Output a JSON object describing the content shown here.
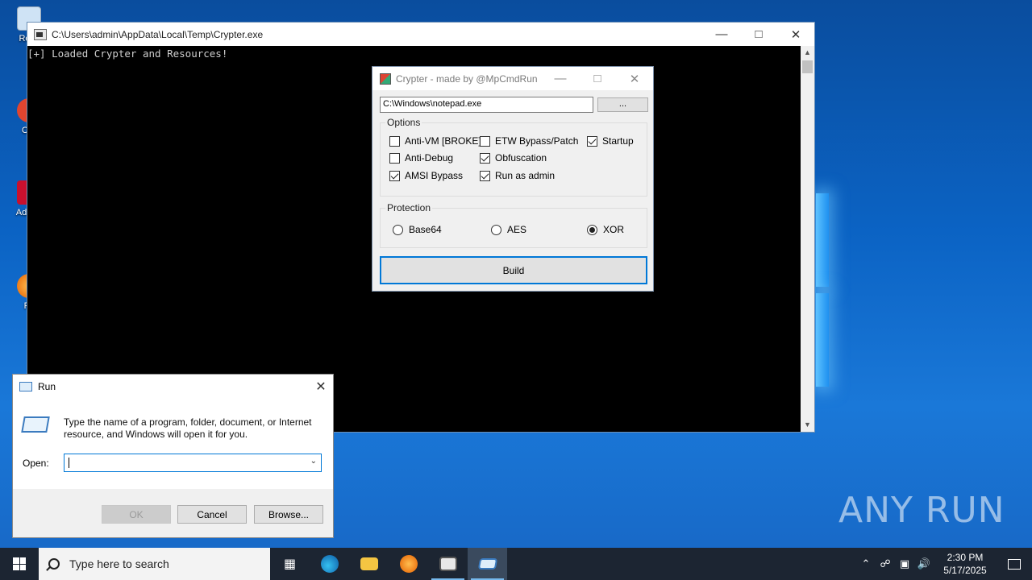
{
  "desktop": {
    "icons": [
      {
        "label": "Recy"
      },
      {
        "label": "CCl"
      },
      {
        "label": "Ad Acr"
      },
      {
        "label": "Fir"
      }
    ],
    "watermark": "ANY RUN"
  },
  "console": {
    "title": "C:\\Users\\admin\\AppData\\Local\\Temp\\Crypter.exe",
    "output": "[+] Loaded Crypter and Resources!"
  },
  "crypter": {
    "title": "Crypter - made by @MpCmdRun",
    "path_value": "C:\\Windows\\notepad.exe",
    "browse_label": "...",
    "options_title": "Options",
    "options": [
      {
        "label": "Anti-VM [BROKE]",
        "checked": false
      },
      {
        "label": "Anti-Debug",
        "checked": false
      },
      {
        "label": "AMSI Bypass",
        "checked": true
      },
      {
        "label": "ETW Bypass/Patch",
        "checked": false
      },
      {
        "label": "Obfuscation",
        "checked": true
      },
      {
        "label": "Run as admin",
        "checked": true
      },
      {
        "label": "Startup",
        "checked": true
      }
    ],
    "protection_title": "Protection",
    "protection": [
      {
        "label": "Base64",
        "selected": false
      },
      {
        "label": "AES",
        "selected": false
      },
      {
        "label": "XOR",
        "selected": true
      }
    ],
    "build_label": "Build"
  },
  "run_dialog": {
    "title": "Run",
    "description": "Type the name of a program, folder, document, or Internet resource, and Windows will open it for you.",
    "open_label": "Open:",
    "open_value": "",
    "ok_label": "OK",
    "cancel_label": "Cancel",
    "browse_label": "Browse..."
  },
  "taskbar": {
    "search_placeholder": "Type here to search",
    "time": "2:30 PM",
    "date": "5/17/2025"
  },
  "colors": {
    "accent": "#0078d7",
    "taskbar": "#1c2532"
  }
}
